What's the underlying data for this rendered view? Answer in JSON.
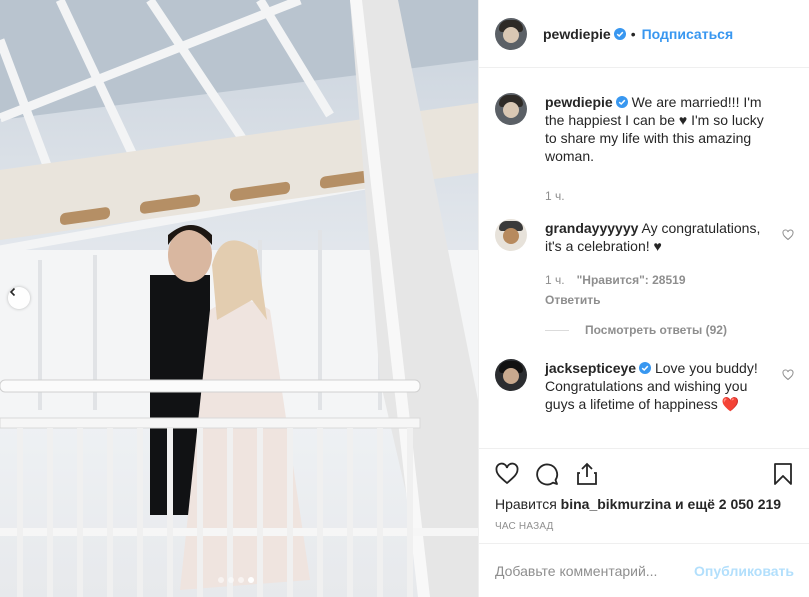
{
  "header": {
    "username": "pewdiepie",
    "separator": "•",
    "follow_label": "Подписаться"
  },
  "caption": {
    "username": "pewdiepie",
    "text": "We are married!!! I'm the happiest I can be ♥ I'm so lucky to share my life with this amazing woman.",
    "time": "1 ч."
  },
  "comments": [
    {
      "username": "grandayyyyyy",
      "text": "Ay congratulations, it's a celebration! ♥",
      "time": "1 ч.",
      "likes": "\"Нравится\": 28519",
      "reply_label": "Ответить",
      "view_replies": "Посмотреть ответы (92)"
    },
    {
      "username": "jacksepticeye",
      "text": "Love you buddy! Congratulations and wishing you guys a lifetime of happiness ❤️"
    }
  ],
  "likes": {
    "prefix": "Нравится",
    "user": "bina_bikmurzina",
    "suffix": "и ещё 2 050 219"
  },
  "time_ago": "час назад",
  "add_comment": {
    "placeholder": "Добавьте комментарий...",
    "publish_label": "Опубликовать"
  },
  "carousel": {
    "count": 4,
    "active_index": 3
  },
  "colors": {
    "accent": "#3897f0",
    "verified": "#3897f0",
    "heart": "#ed4956",
    "publish_disabled": "#b2dffc"
  },
  "icons": [
    "chevron-left-icon",
    "heart-icon",
    "comment-icon",
    "share-icon",
    "bookmark-icon",
    "verified-badge-icon"
  ]
}
